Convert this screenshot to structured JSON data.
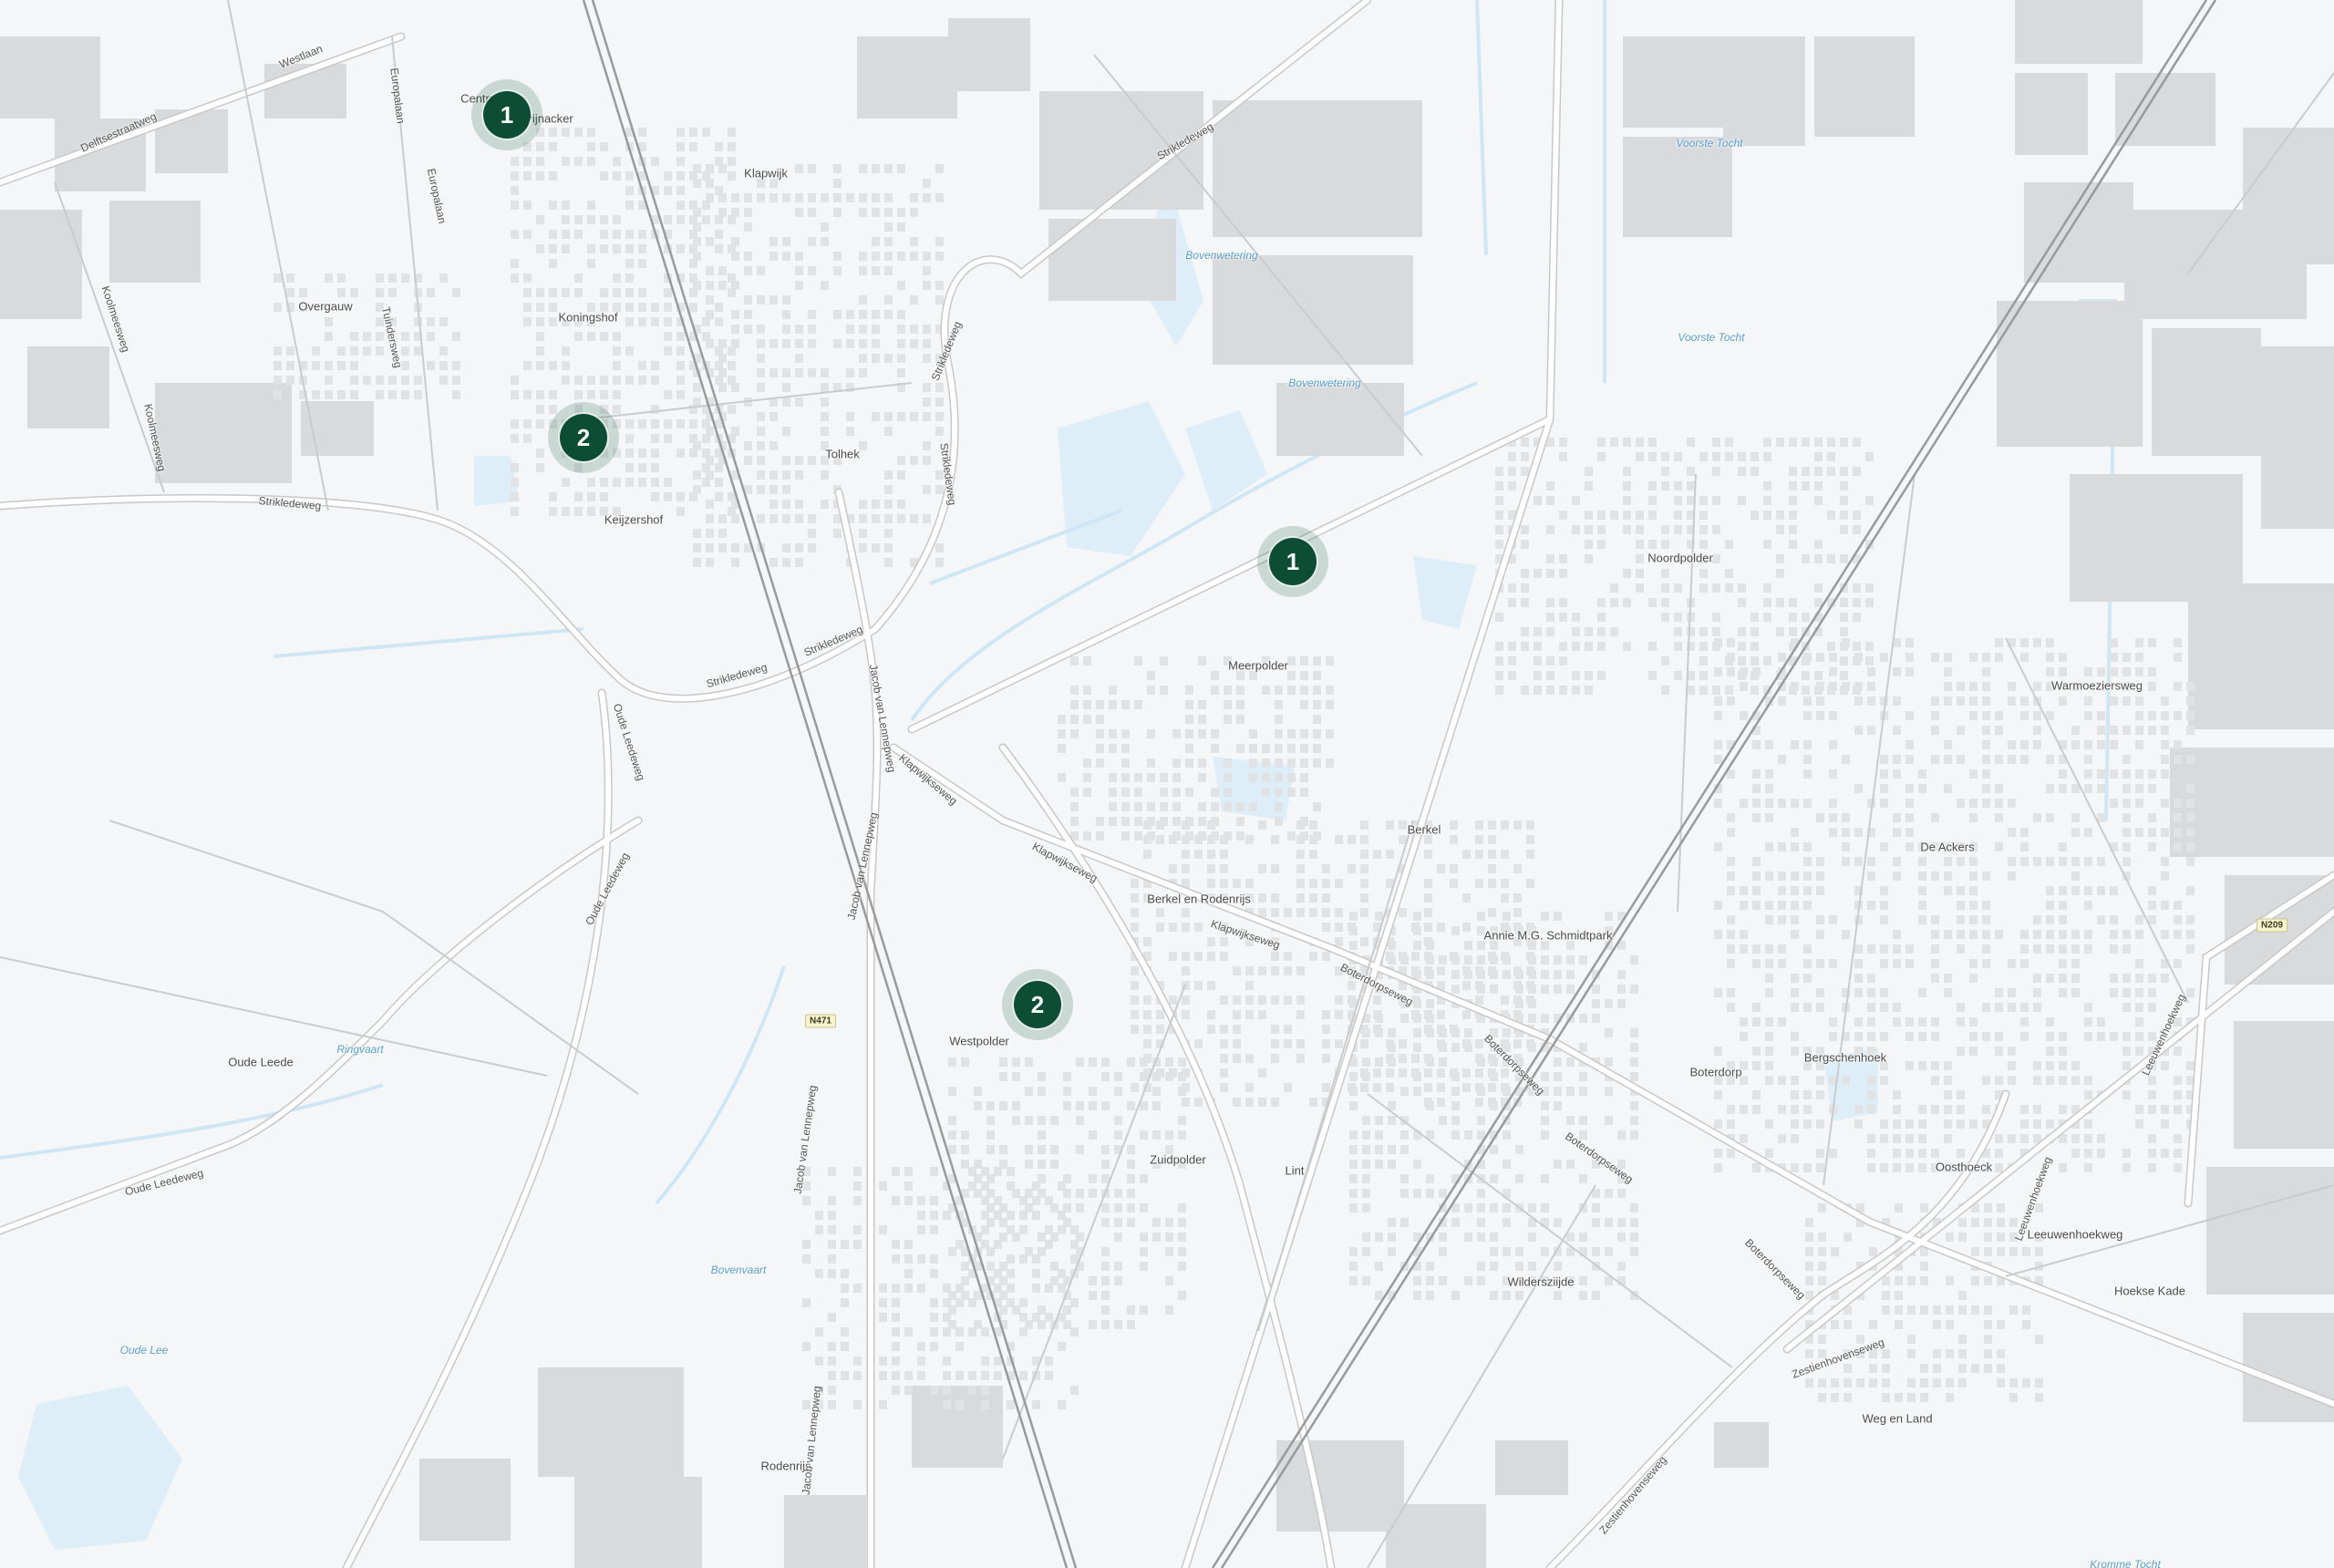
{
  "map": {
    "colors": {
      "background": "#f5f6f7",
      "building": "#d9dadc",
      "water": "#ddeef8",
      "road": "#ffffff",
      "road_casing": "#c6c8ca",
      "rail": "#9a9a9a",
      "marker": "#0d4d35"
    },
    "markers": [
      {
        "label": "1"
      },
      {
        "label": "2"
      },
      {
        "label": "1"
      },
      {
        "label": "2"
      }
    ],
    "places": [
      "Centrum",
      "Pijnacker",
      "Klapwijk",
      "Koningshof",
      "Overgauw",
      "Tolhek",
      "Keijzershof",
      "Meerpolder",
      "Noordpolder",
      "Berkel",
      "Berkel en Rodenrijs",
      "Annie M.G. Schmidtpark",
      "Westpolder",
      "Zuidpolder",
      "Lint",
      "Boterdorp",
      "Bergschenhoek",
      "Oosthoeck",
      "Leeuwenhoekweg",
      "Hoekse Kade",
      "Wildersziijde",
      "Weg en Land",
      "De Ackers",
      "Warmoeziersweg",
      "Oude Leede",
      "Rodenrijs"
    ],
    "streets": [
      "Westlaan",
      "Delftsestraatweg",
      "Europalaan",
      "Europalaan",
      "Koolmeesweg",
      "Koolmeesweg",
      "Tuindersweg",
      "Strikledeweg",
      "Strikledeweg",
      "Strikledeweg",
      "Strikledeweg",
      "Strikledeweg",
      "Strikledeweg",
      "Jacob van Lennepweg",
      "Jacob van Lennepweg",
      "Jacob van Lennepweg",
      "Jacob van Lennepweg",
      "Klapwijkseweg",
      "Klapwijkseweg",
      "Klapwijkseweg",
      "Boterdorpseweg",
      "Boterdorpseweg",
      "Boterdorpseweg",
      "Boterdorpseweg",
      "Oude Leedeweg",
      "Oude Leedeweg",
      "Oude Leedeweg",
      "Zestienhovenseweg",
      "Zestienhovenseweg",
      "Leeuwenhoekweg",
      "Leeuwenhoekweg"
    ],
    "waters": [
      "Voorste Tocht",
      "Voorste Tocht",
      "Bovenwetering",
      "Bovenwetering",
      "Ringvaart",
      "Bovenvaart",
      "Oude Lee",
      "Kromme Tocht"
    ],
    "shields": [
      "N471",
      "N209"
    ]
  }
}
